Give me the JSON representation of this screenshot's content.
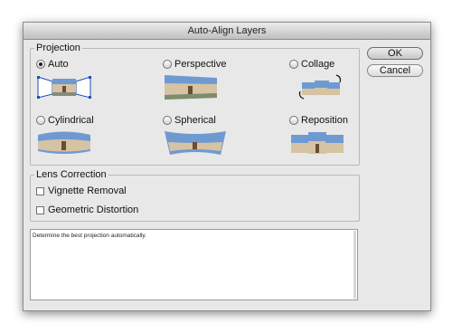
{
  "window": {
    "title": "Auto-Align Layers"
  },
  "projection": {
    "legend": "Projection",
    "options": [
      {
        "label": "Auto",
        "selected": true
      },
      {
        "label": "Perspective",
        "selected": false
      },
      {
        "label": "Collage",
        "selected": false
      },
      {
        "label": "Cylindrical",
        "selected": false
      },
      {
        "label": "Spherical",
        "selected": false
      },
      {
        "label": "Reposition",
        "selected": false
      }
    ]
  },
  "lens_correction": {
    "legend": "Lens Correction",
    "options": [
      {
        "label": "Vignette Removal",
        "checked": false
      },
      {
        "label": "Geometric Distortion",
        "checked": false
      }
    ]
  },
  "description": {
    "text": "Determine the best projection automatically."
  },
  "buttons": {
    "ok": "OK",
    "cancel": "Cancel"
  },
  "colors": {
    "sky": "#6f9ad1",
    "building": "#d6c3a3",
    "handles": "#1f4fb5"
  }
}
